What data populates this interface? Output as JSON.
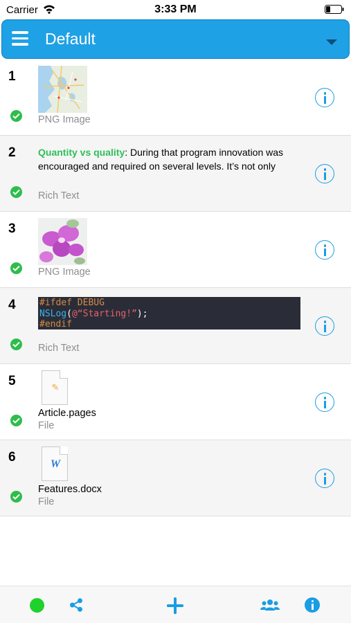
{
  "status_bar": {
    "carrier": "Carrier",
    "time": "3:33 PM"
  },
  "header": {
    "title": "Default"
  },
  "items": [
    {
      "number": "1",
      "subtitle": "PNG Image",
      "status": "synced"
    },
    {
      "number": "2",
      "subtitle": "Rich Text",
      "status": "synced",
      "text_bold": "Quantity vs quality",
      "text_rest": ": During that program innovation was encouraged and required on several levels. It’s not only"
    },
    {
      "number": "3",
      "subtitle": "PNG Image",
      "status": "synced"
    },
    {
      "number": "4",
      "subtitle": "Rich Text",
      "status": "synced",
      "code": {
        "line1": "#ifdef DEBUG",
        "fn": "NSLog",
        "open": "(",
        "str": "@“Starting!”",
        "close": ");",
        "line3": "#endif"
      }
    },
    {
      "number": "5",
      "subtitle": "File",
      "status": "synced",
      "filename": "Article.pages",
      "icon": "pages-document-icon"
    },
    {
      "number": "6",
      "subtitle": "File",
      "status": "synced",
      "filename": "Features.docx",
      "icon": "word-document-icon",
      "glyph": "W"
    }
  ],
  "colors": {
    "accent": "#1fa1e6",
    "check": "#2ebd4b",
    "status_dot": "#1fd12c",
    "keyword": "#2fbf5a",
    "info": "#1a9de3"
  }
}
